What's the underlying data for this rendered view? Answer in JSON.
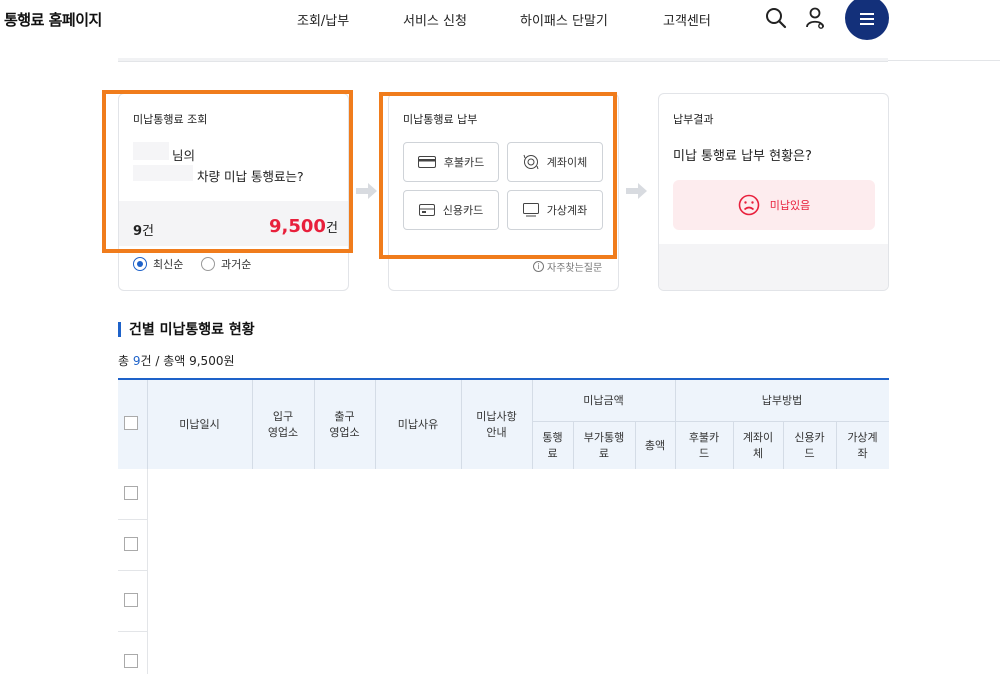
{
  "header": {
    "logo": "통행료 홈페이지",
    "nav": [
      "조회/납부",
      "서비스 신청",
      "하이패스 단말기",
      "고객센터"
    ]
  },
  "card_inquiry": {
    "title": "미납통행료 조회",
    "name_suffix": "님의",
    "vehicle_text": "차량 미납 통행료는?",
    "count_value": "9",
    "count_unit": "건",
    "amount_value": "9,500",
    "amount_unit": "건",
    "sort_options": [
      "최신순",
      "과거순"
    ],
    "sort_selected": "최신순"
  },
  "card_payment": {
    "title": "미납통행료 납부",
    "methods": [
      "후불카드",
      "계좌이체",
      "신용카드",
      "가상계좌"
    ],
    "faq": "자주찾는질문"
  },
  "card_result": {
    "title": "납부결과",
    "question": "미납 통행료 납부 현황은?",
    "status": "미납있음"
  },
  "section": {
    "title": "건별 미납통행료 현황",
    "summary_prefix": "총 ",
    "summary_count": "9",
    "summary_rest": "건 / 총액 9,500원"
  },
  "table": {
    "headers": {
      "datetime": "미납일시",
      "entry": "입구\n영업소",
      "exit": "출구\n영업소",
      "reason": "미납사유",
      "notice": "미납사항\n안내",
      "amount_group": "미납금액",
      "toll": "통행\n료",
      "surcharge": "부가통행\n료",
      "total": "총액",
      "method_group": "납부방법",
      "postpaid": "후불카\n드",
      "transfer": "계좌이\n체",
      "credit": "신용카\n드",
      "virtual": "가상계\n좌"
    }
  },
  "colors": {
    "brand": "#13307a",
    "accent_blue": "#1e62c9",
    "amount_red": "#e8203c",
    "highlight_orange": "#f07c1c"
  }
}
